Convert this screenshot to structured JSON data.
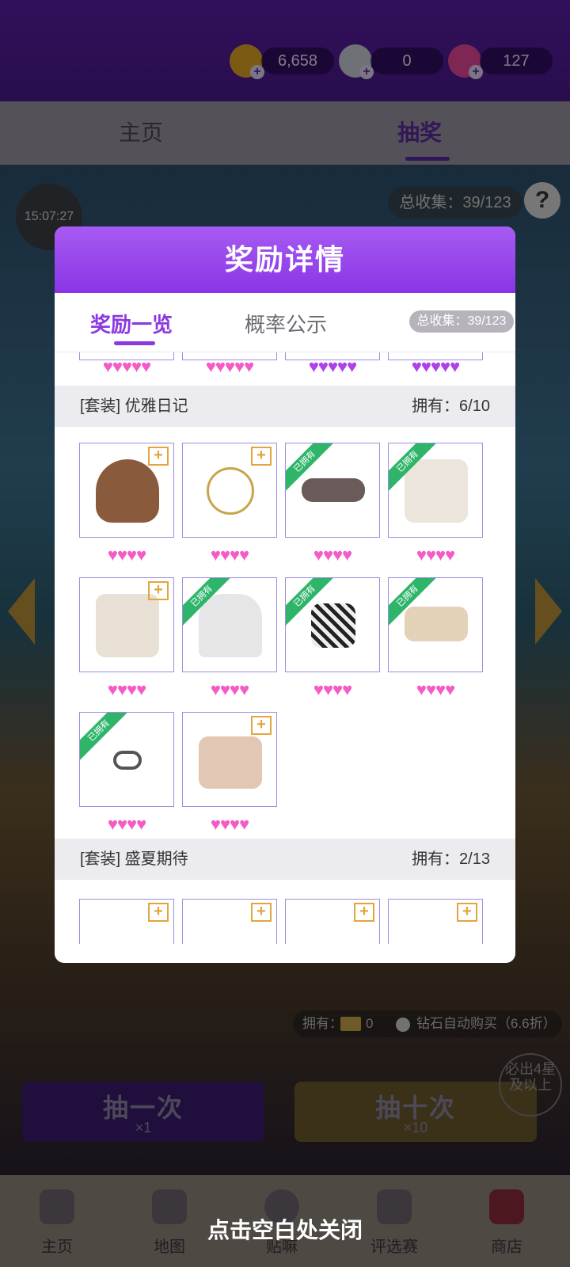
{
  "currency": {
    "coins": "6,658",
    "diamonds": "0",
    "gems": "127"
  },
  "tabs": {
    "home": "主页",
    "lottery": "抽奖"
  },
  "timer": "15:07:27",
  "total_collect": "总收集：39/123",
  "help": "?",
  "modal": {
    "title": "奖励详情",
    "tab_list": "奖励一览",
    "tab_prob": "概率公示",
    "total_collect": "总收集：39/123",
    "sets": [
      {
        "name": "[套装] 优雅日记",
        "owned": "拥有：6/10"
      },
      {
        "name": "[套装] 盛夏期待",
        "owned": "拥有：2/13"
      }
    ],
    "owned_ribbon": "已拥有",
    "plus": "+",
    "hearts4": "♥♥♥♥",
    "hearts5": "♥♥♥♥♥"
  },
  "bottom": {
    "own_label": "拥有：",
    "ticket_count": "0",
    "auto_buy": "钻石自动购买（6.6折）",
    "draw_once": "抽一次",
    "draw_once_cost": "×1",
    "draw_ten": "抽十次",
    "draw_ten_cost": "×10",
    "badge": "必出4星及以上"
  },
  "nav": {
    "home": "主页",
    "map": "地图",
    "third": "贴嘛",
    "contest": "评选赛",
    "shop": "商店"
  },
  "close_hint": "点击空白处关闭",
  "colors": {
    "accent": "#8b3ae0",
    "owned_green": "#2fb56a",
    "heart_pink": "#f45bc6",
    "heart_purple": "#b040e8"
  }
}
